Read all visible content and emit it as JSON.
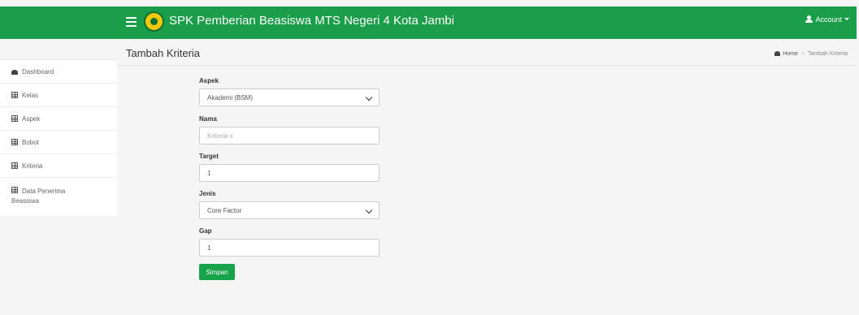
{
  "app": {
    "title": "SPK Pemberian Beasiswa MTS Negeri 4 Kota Jambi"
  },
  "account": {
    "label": "Account",
    "icon": "user-icon"
  },
  "sidebar": {
    "items": [
      {
        "label": "Dashboard",
        "icon": "dashboard-icon"
      },
      {
        "label": "Kelas",
        "icon": "table-icon"
      },
      {
        "label": "Aspek",
        "icon": "table-icon"
      },
      {
        "label": "Bobot",
        "icon": "table-icon"
      },
      {
        "label": "Kriteria",
        "icon": "table-icon"
      },
      {
        "label_line1": "Data Penerima",
        "label_line2": "Beasiswa",
        "icon": "table-icon"
      }
    ]
  },
  "page": {
    "title": "Tambah Kriteria"
  },
  "breadcrumb": {
    "home": "Home",
    "current": "Tambah Kriteria"
  },
  "form": {
    "aspek": {
      "label": "Aspek",
      "value": "Akademi (BSM)"
    },
    "nama": {
      "label": "Nama",
      "placeholder": "Kriteria x"
    },
    "target": {
      "label": "Target",
      "value": "1"
    },
    "jenis": {
      "label": "Jenis",
      "value": "Core Factor"
    },
    "gap": {
      "label": "Gap",
      "value": "1"
    },
    "submit_label": "Simpan"
  },
  "colors": {
    "navbar": "#1a9e4a",
    "button": "#16a34a"
  }
}
